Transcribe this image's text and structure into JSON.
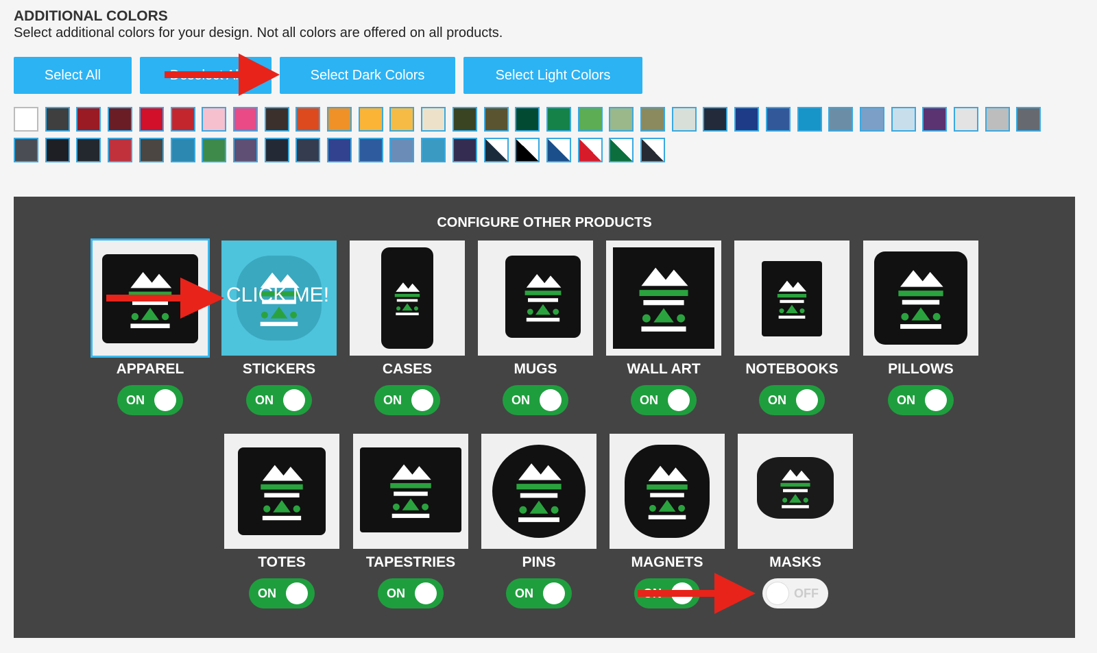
{
  "header": {
    "title": "ADDITIONAL COLORS",
    "subtitle": "Select additional colors for your design. Not all colors are offered on all products."
  },
  "buttons": {
    "select_all": "Select All",
    "deselect_all": "Deselect All",
    "select_dark": "Select Dark Colors",
    "select_light": "Select Light Colors"
  },
  "swatch_colors_row1": [
    "#ffffff",
    "#3f3f3f",
    "#9a1b23",
    "#6b1d25",
    "#d3102a",
    "#c4262e",
    "#f7c0cf",
    "#ea4a86",
    "#3b302c",
    "#dd4a1e",
    "#ef9126",
    "#fbb435",
    "#f6bb45",
    "#ede2c9",
    "#3a4423",
    "#5a5430",
    "#024a32",
    "#158248",
    "#5cad54",
    "#9ab88a",
    "#8a8a5e",
    "#d7dfd8",
    "#232b3b",
    "#1e3b87",
    "#33589a",
    "#1795c8",
    "#6b8ea6",
    "#7c9fc7",
    "#c9deeb",
    "#5b3371",
    "#e3e3e3",
    "#bdbdbd",
    "#666a70"
  ],
  "swatch_colors_row2": [
    "#4a4d54",
    "#1e1f25",
    "#23282f",
    "#c0313c",
    "#4b4641",
    "#2c88b1",
    "#3e8a4b",
    "#5f4f74",
    "#232a36",
    "#353c4f",
    "#33428e",
    "#2d5b9d",
    "#6a8cb7",
    "#3a9ac2",
    "#342d51",
    "#1a2c3c",
    "#000000",
    "#1b4f8b",
    "#d81b2a",
    "#0b6e3c",
    "#262b33"
  ],
  "configure": {
    "title": "CONFIGURE OTHER PRODUCTS",
    "click_me": "CLICK ME!",
    "products": [
      {
        "label": "APPAREL",
        "toggle": "ON"
      },
      {
        "label": "STICKERS",
        "toggle": "ON"
      },
      {
        "label": "CASES",
        "toggle": "ON"
      },
      {
        "label": "MUGS",
        "toggle": "ON"
      },
      {
        "label": "WALL ART",
        "toggle": "ON"
      },
      {
        "label": "NOTEBOOKS",
        "toggle": "ON"
      },
      {
        "label": "PILLOWS",
        "toggle": "ON"
      },
      {
        "label": "TOTES",
        "toggle": "ON"
      },
      {
        "label": "TAPESTRIES",
        "toggle": "ON"
      },
      {
        "label": "PINS",
        "toggle": "ON"
      },
      {
        "label": "MAGNETS",
        "toggle": "ON"
      },
      {
        "label": "MASKS",
        "toggle": "OFF"
      }
    ]
  },
  "accent_color": "#2bb3f4",
  "toggle_on_color": "#1f9e3e",
  "arrow_color": "#e8231a"
}
